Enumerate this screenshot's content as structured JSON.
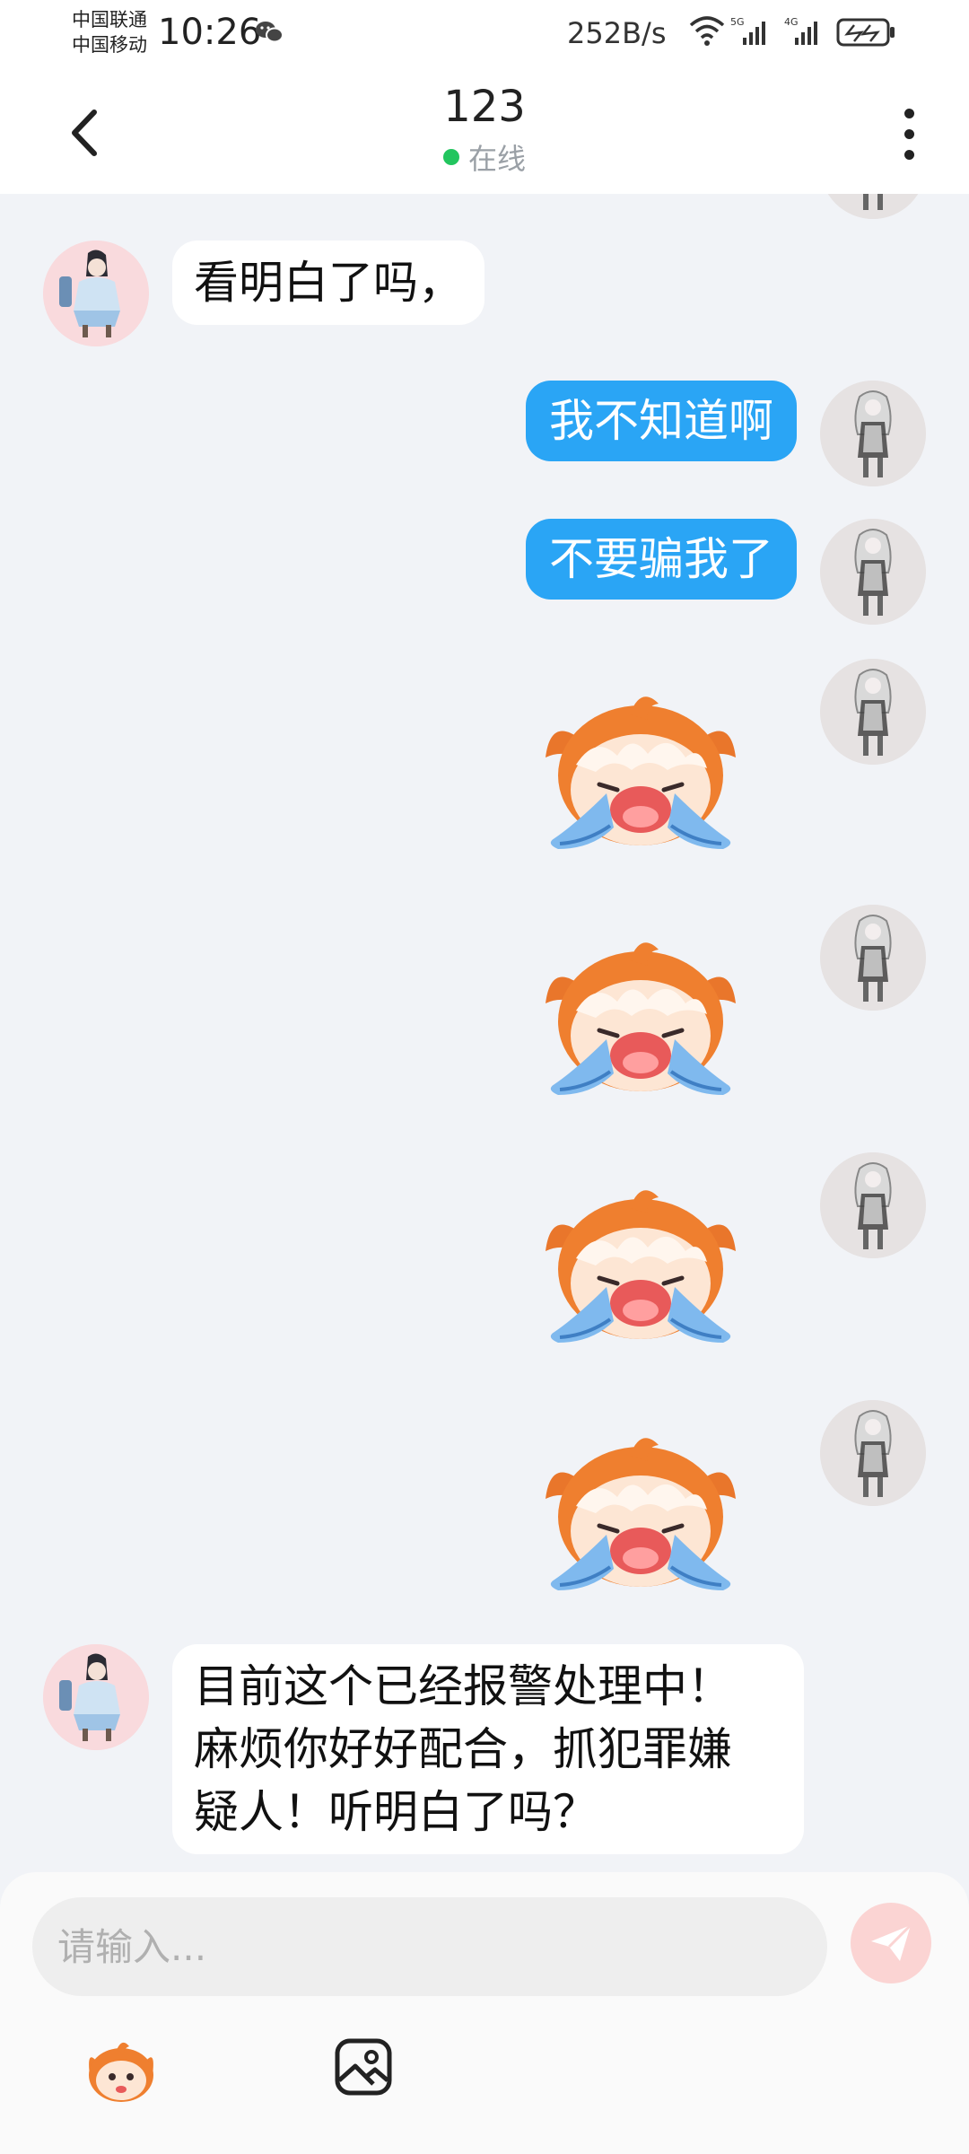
{
  "status_bar": {
    "carrier_1": "中国联通",
    "carrier_2": "中国移动",
    "time": "10:26",
    "net_speed": "252B/s",
    "signal_1_label": "5G",
    "signal_2_label": "4G",
    "icons": [
      "wechat-icon",
      "wifi-icon",
      "signal-icon",
      "battery-charging-icon"
    ]
  },
  "header": {
    "title": "123",
    "status": "在线",
    "status_color": "#22c55e",
    "back_icon": "chevron-left-icon",
    "menu_icon": "more-vertical-icon"
  },
  "messages": [
    {
      "from": "her",
      "type": "text",
      "text": "看明白了吗，"
    },
    {
      "from": "me",
      "type": "text",
      "text": "我不知道啊"
    },
    {
      "from": "me",
      "type": "text",
      "text": "不要骗我了"
    },
    {
      "from": "me",
      "type": "sticker",
      "sticker": "crying-fox-sticker"
    },
    {
      "from": "me",
      "type": "sticker",
      "sticker": "crying-fox-sticker"
    },
    {
      "from": "me",
      "type": "sticker",
      "sticker": "crying-fox-sticker"
    },
    {
      "from": "me",
      "type": "sticker",
      "sticker": "crying-fox-sticker"
    },
    {
      "from": "her",
      "type": "text",
      "lines": [
        "目前这个已经报警处理中！",
        "麻烦你好好配合，抓犯罪嫌",
        "疑人！听明白了吗？"
      ]
    }
  ],
  "input": {
    "placeholder": "请输入...",
    "value": ""
  },
  "toolbar": {
    "send_icon": "send-icon",
    "sticker_icon": "sticker-icon",
    "image_icon": "image-icon"
  },
  "colors": {
    "outgoing_bubble": "#2aa5f5",
    "incoming_bubble": "#ffffff",
    "background": "#f1f3f7",
    "send_button": "#fbd4d3"
  }
}
